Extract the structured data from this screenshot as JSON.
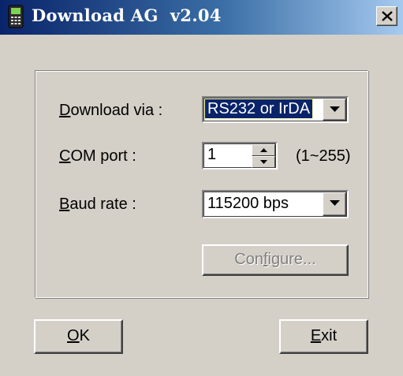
{
  "window": {
    "title": "Download AG  v2.04",
    "close_label": "×"
  },
  "form": {
    "download_via": {
      "label_mnemonic": "D",
      "label_rest": "ownload via :",
      "value": "RS232 or IrDA"
    },
    "com_port": {
      "label_mnemonic": "C",
      "label_rest": "OM port :",
      "value": "1",
      "range_hint": "(1~255)"
    },
    "baud_rate": {
      "label_mnemonic": "B",
      "label_rest": "aud rate :",
      "value": "115200 bps"
    },
    "configure_button": {
      "label_before": "Con",
      "label_mnemonic": "f",
      "label_after": "igure...",
      "enabled": false
    }
  },
  "buttons": {
    "ok": {
      "label_mnemonic": "O",
      "label_rest": "K"
    },
    "exit": {
      "label_mnemonic": "E",
      "label_rest": "xit"
    }
  },
  "icons": {
    "app": "barcode-terminal-icon",
    "close": "close-icon",
    "dropdown": "chevron-down-icon",
    "spin_up": "caret-up-icon",
    "spin_down": "caret-down-icon"
  },
  "colors": {
    "titlebar_start": "#0a246a",
    "titlebar_end": "#a6caf0",
    "face": "#d4d0c8",
    "selection": "#0a246a"
  }
}
